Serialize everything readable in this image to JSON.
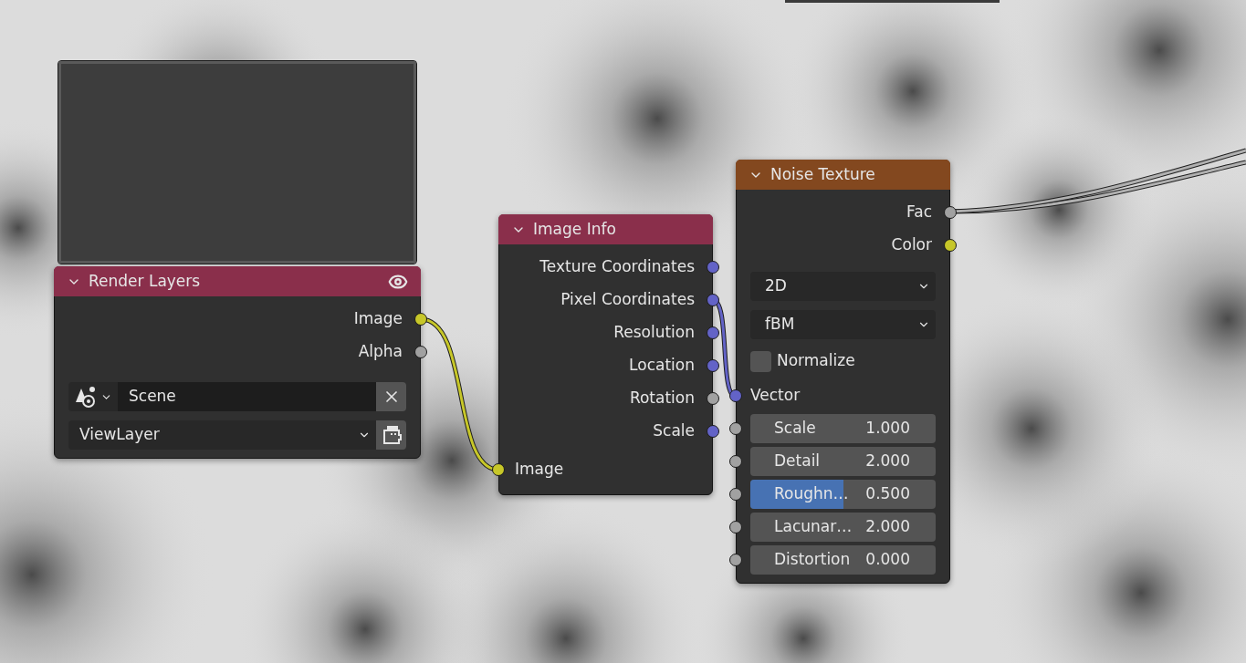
{
  "nodes": [
    {
      "kind": "render_layers",
      "title": "Render Layers",
      "color": "#8a2f4b",
      "preview": true,
      "outputs": [
        {
          "label": "Image",
          "color": "#c7c729"
        },
        {
          "label": "Alpha",
          "color": "#a1a1a1"
        }
      ],
      "scene": {
        "value": "Scene"
      },
      "view_layer": {
        "value": "ViewLayer"
      }
    },
    {
      "kind": "image_info",
      "title": "Image Info",
      "color": "#8a2f4b",
      "outputs": [
        {
          "label": "Texture Coordinates",
          "color": "#6363c7"
        },
        {
          "label": "Pixel Coordinates",
          "color": "#6363c7"
        },
        {
          "label": "Resolution",
          "color": "#6363c7"
        },
        {
          "label": "Location",
          "color": "#6363c7"
        },
        {
          "label": "Rotation",
          "color": "#a1a1a1"
        },
        {
          "label": "Scale",
          "color": "#6363c7"
        }
      ],
      "inputs": [
        {
          "label": "Image",
          "color": "#c7c729"
        }
      ]
    },
    {
      "kind": "noise_texture",
      "title": "Noise Texture",
      "color": "#83481f",
      "outputs": [
        {
          "label": "Fac",
          "color": "#a1a1a1"
        },
        {
          "label": "Color",
          "color": "#c7c729"
        }
      ],
      "dropdowns": [
        "2D",
        "fBM"
      ],
      "normalize": {
        "label": "Normalize",
        "checked": false
      },
      "vector": {
        "label": "Vector",
        "color": "#6363c7"
      },
      "fields": [
        {
          "kind": "number",
          "label": "Scale",
          "value": "1.000"
        },
        {
          "kind": "number",
          "label": "Detail",
          "value": "2.000"
        },
        {
          "kind": "slider",
          "label": "Roughn…",
          "value": "0.500",
          "level": 0.5
        },
        {
          "kind": "number",
          "label": "Lacunar…",
          "value": "2.000"
        },
        {
          "kind": "number",
          "label": "Distortion",
          "value": "0.000"
        }
      ]
    }
  ]
}
